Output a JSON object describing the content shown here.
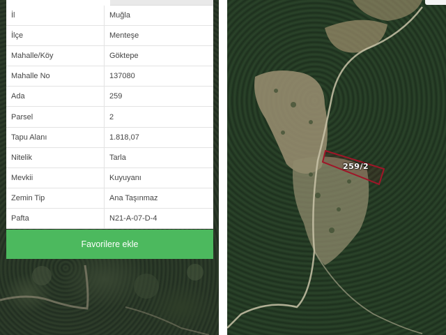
{
  "info_table": {
    "rows": [
      {
        "key": "İl",
        "value": "Muğla"
      },
      {
        "key": "İlçe",
        "value": "Menteşe"
      },
      {
        "key": "Mahalle/Köy",
        "value": "Göktepe"
      },
      {
        "key": "Mahalle No",
        "value": "137080"
      },
      {
        "key": "Ada",
        "value": "259"
      },
      {
        "key": "Parsel",
        "value": "2"
      },
      {
        "key": "Tapu Alanı",
        "value": "1.818,07"
      },
      {
        "key": "Nitelik",
        "value": "Tarla"
      },
      {
        "key": "Mevkii",
        "value": "Kuyuyanı"
      },
      {
        "key": "Zemin Tip",
        "value": "Ana Taşınmaz"
      },
      {
        "key": "Pafta",
        "value": "N21-A-07-D-4"
      }
    ]
  },
  "favorite_button": {
    "label": "Favorilere ekle",
    "color": "#4cb95e"
  },
  "map": {
    "parcel_label": "259/2",
    "parcel_outline_color": "#a01528"
  }
}
